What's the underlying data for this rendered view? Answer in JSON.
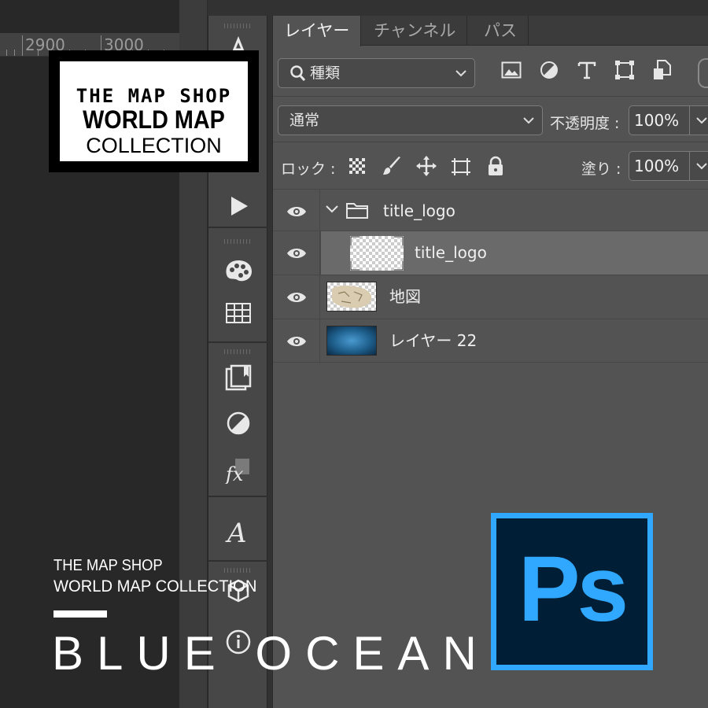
{
  "ruler": {
    "labels": [
      "2900",
      "3000"
    ]
  },
  "panel": {
    "collapse_icon": "‹‹",
    "tabs": [
      {
        "label": "レイヤー",
        "active": true
      },
      {
        "label": "チャンネル",
        "active": false
      },
      {
        "label": "パス",
        "active": false
      }
    ],
    "filter": {
      "kind_label": "種類",
      "icons": [
        "image-filter-icon",
        "adjustment-filter-icon",
        "type-filter-icon",
        "shape-filter-icon",
        "smart-object-filter-icon"
      ]
    },
    "blend_mode": "通常",
    "opacity_label": "不透明度 :",
    "opacity_value": "100%",
    "lock_label": "ロック :",
    "lock_icons": [
      "lock-transparent-pixels-icon",
      "lock-image-pixels-icon",
      "lock-position-icon",
      "lock-artboard-icon",
      "lock-all-icon"
    ],
    "fill_label": "塗り :",
    "fill_value": "100%",
    "layers": [
      {
        "name": "title_logo",
        "type": "group",
        "expanded": true
      },
      {
        "name": "title_logo",
        "type": "layer",
        "selected": true
      },
      {
        "name": "地図",
        "type": "layer"
      },
      {
        "name": "レイヤー 22",
        "type": "layer"
      }
    ]
  },
  "toolbar": {
    "icons": [
      "text-icon",
      "play-icon",
      "swatches-icon",
      "grid-icon",
      "libraries-icon",
      "adjustments-icon",
      "fx-icon",
      "glyphs-icon",
      "3d-icon",
      "info-icon"
    ]
  },
  "overlay": {
    "logo_line1": "THE MAP SHOP",
    "logo_line2": "WORLD MAP",
    "logo_line3": "COLLECTION",
    "caption_line1": "THE MAP SHOP",
    "caption_line2": "WORLD MAP COLLECTION",
    "headline": "BLUE OCEAN",
    "ps_logo_text": "Ps"
  },
  "colors": {
    "ps_blue": "#31a8ff",
    "ps_dark": "#001e36",
    "panel_bg": "#535353",
    "selected_row": "#6a6a6a"
  }
}
